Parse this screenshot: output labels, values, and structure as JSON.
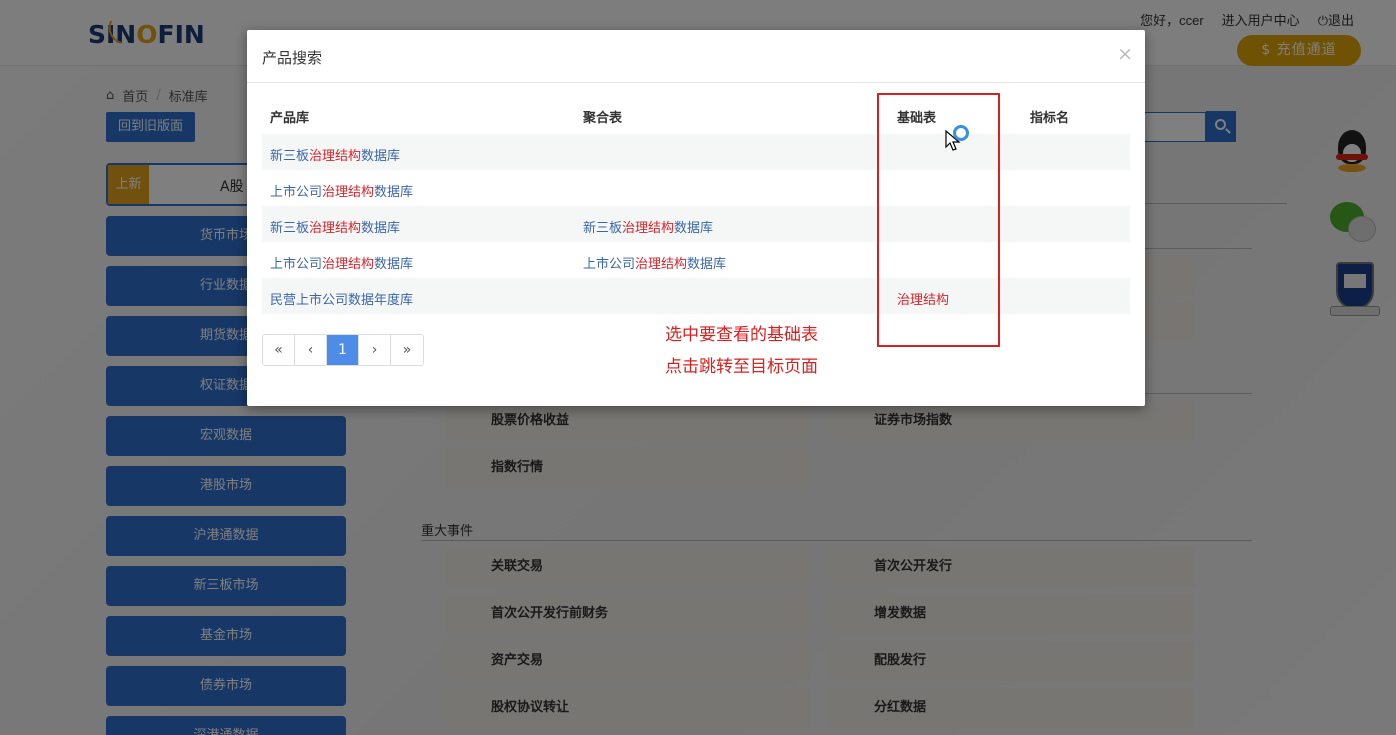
{
  "header": {
    "logo_text_pre": "SIN",
    "logo_text_o": "O",
    "logo_text_post": "FIN",
    "greeting": "您好，ccer",
    "user_center": "进入用户中心",
    "logout": "退出",
    "recharge": "$ 充值通道"
  },
  "breadcrumb": {
    "home": "首页",
    "current": "标准库"
  },
  "old_version_button": "回到旧版面",
  "new_tab": {
    "badge": "上新",
    "label": "A股"
  },
  "sidebar": {
    "items": [
      {
        "label": "货币市场"
      },
      {
        "label": "行业数据"
      },
      {
        "label": "期货数据"
      },
      {
        "label": "权证数据"
      },
      {
        "label": "宏观数据"
      },
      {
        "label": "港股市场"
      },
      {
        "label": "沪港通数据"
      },
      {
        "label": "新三板市场"
      },
      {
        "label": "基金市场"
      },
      {
        "label": "债券市场"
      },
      {
        "label": "深港通数据"
      }
    ]
  },
  "content": {
    "cells_top": [
      "股票价格收益",
      "证券市场指数",
      "指数行情"
    ],
    "section_title": "重大事件",
    "cells_events": [
      "关联交易",
      "首次公开发行",
      "首次公开发行前财务",
      "增发数据",
      "资产交易",
      "配股发行",
      "股权协议转让",
      "分红数据"
    ]
  },
  "modal": {
    "title": "产品搜索",
    "close": "×",
    "columns": [
      "产品库",
      "聚合表",
      "基础表",
      "指标名"
    ],
    "rows": [
      {
        "product_pre": "新三板",
        "product_hl": "治理结构",
        "product_post": "数据库",
        "agg_pre": "",
        "agg_hl": "",
        "agg_post": "",
        "base": ""
      },
      {
        "product_pre": "上市公司",
        "product_hl": "治理结构",
        "product_post": "数据库",
        "agg_pre": "",
        "agg_hl": "",
        "agg_post": "",
        "base": ""
      },
      {
        "product_pre": "新三板",
        "product_hl": "治理结构",
        "product_post": "数据库",
        "agg_pre": "新三板",
        "agg_hl": "治理结构",
        "agg_post": "数据库",
        "base": ""
      },
      {
        "product_pre": "上市公司",
        "product_hl": "治理结构",
        "product_post": "数据库",
        "agg_pre": "上市公司",
        "agg_hl": "治理结构",
        "agg_post": "数据库",
        "base": ""
      },
      {
        "product_pre": "民营上市公司数据年度库",
        "product_hl": "",
        "product_post": "",
        "agg_pre": "",
        "agg_hl": "",
        "agg_post": "",
        "base": "治理结构"
      }
    ],
    "pager": {
      "first": "«",
      "prev": "‹",
      "current": "1",
      "next": "›",
      "last": "»"
    }
  },
  "annotation": {
    "line1": "选中要查看的基础表",
    "line2": "点击跳转至目标页面",
    "color": "#d92020"
  },
  "colors": {
    "primary_blue": "#2f6fcf",
    "accent_gold": "#e3a21a",
    "highlight_red": "#d9232a"
  }
}
